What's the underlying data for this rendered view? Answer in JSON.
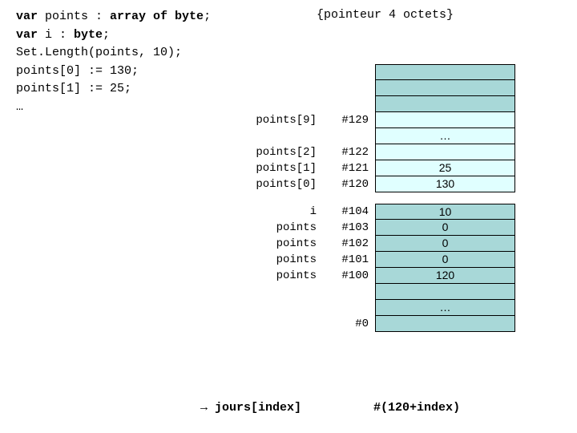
{
  "code": {
    "l1a": "var",
    "l1b": " points : ",
    "l1c": "array of byte",
    "l1d": ";",
    "l2a": "var",
    "l2b": " i : ",
    "l2c": "byte",
    "l2d": ";",
    "l3": "Set.Length(points, 10);",
    "l4": "points[0] := 130;",
    "l5": "points[1] := 25;",
    "l6": "…"
  },
  "comment": "{pointeur 4 octets}",
  "rows": [
    {
      "lbl": "",
      "addr": "",
      "val": "",
      "cls": "teal first"
    },
    {
      "lbl": "",
      "addr": "",
      "val": "",
      "cls": "teal"
    },
    {
      "lbl": "",
      "addr": "",
      "val": "",
      "cls": "teal"
    },
    {
      "lbl": "points[9]",
      "addr": "#129",
      "val": "",
      "cls": "lightcyan"
    },
    {
      "lbl": "",
      "addr": "",
      "val": "…",
      "cls": "lightcyan"
    },
    {
      "lbl": "points[2]",
      "addr": "#122",
      "val": "",
      "cls": "lightcyan"
    },
    {
      "lbl": "points[1]",
      "addr": "#121",
      "val": "25",
      "cls": "lightcyan"
    },
    {
      "lbl": "points[0]",
      "addr": "#120",
      "val": "130",
      "cls": "lightcyan"
    },
    {
      "gap": true
    },
    {
      "lbl": "i",
      "addr": "#104",
      "val": "10",
      "cls": "teal first"
    },
    {
      "lbl": "points",
      "addr": "#103",
      "val": "0",
      "cls": "teal"
    },
    {
      "lbl": "points",
      "addr": "#102",
      "val": "0",
      "cls": "teal"
    },
    {
      "lbl": "points",
      "addr": "#101",
      "val": "0",
      "cls": "teal"
    },
    {
      "lbl": "points",
      "addr": "#100",
      "val": "120",
      "cls": "teal"
    },
    {
      "lbl": "",
      "addr": "",
      "val": "",
      "cls": "teal"
    },
    {
      "lbl": "",
      "addr": "",
      "val": "…",
      "cls": "teal"
    },
    {
      "lbl": "",
      "addr": "#0",
      "val": "",
      "cls": "teal"
    }
  ],
  "footer": {
    "arrow": "→",
    "left": " jours[index]",
    "right": "#(120+index)"
  }
}
